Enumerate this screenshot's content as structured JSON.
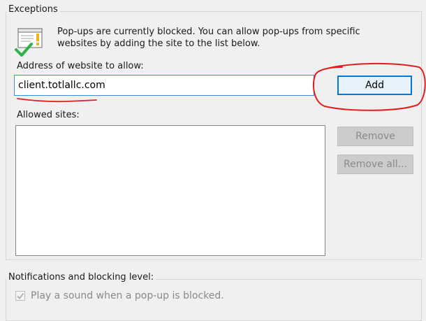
{
  "exceptions": {
    "legend": "Exceptions",
    "info_line1": "Pop-ups are currently blocked.  You can allow pop-ups from specific",
    "info_line2": "websites by adding the site to the list below.",
    "address_label": "Address of website to allow:",
    "address_value": "client.totlallc.com",
    "add_label": "Add",
    "allowed_label": "Allowed sites:",
    "allowed_sites": [],
    "remove_label": "Remove",
    "remove_all_label": "Remove all..."
  },
  "notifications": {
    "legend": "Notifications and blocking level:",
    "sound_label": "Play a sound when a pop-up is blocked.",
    "sound_checked": true,
    "sound_enabled": false
  },
  "icons": {
    "info": "popup-blocker-icon",
    "check": "checkmark-icon"
  },
  "colors": {
    "accent": "#0078d7",
    "annotation": "#e02020",
    "disabled_text": "#8a8a8a"
  }
}
